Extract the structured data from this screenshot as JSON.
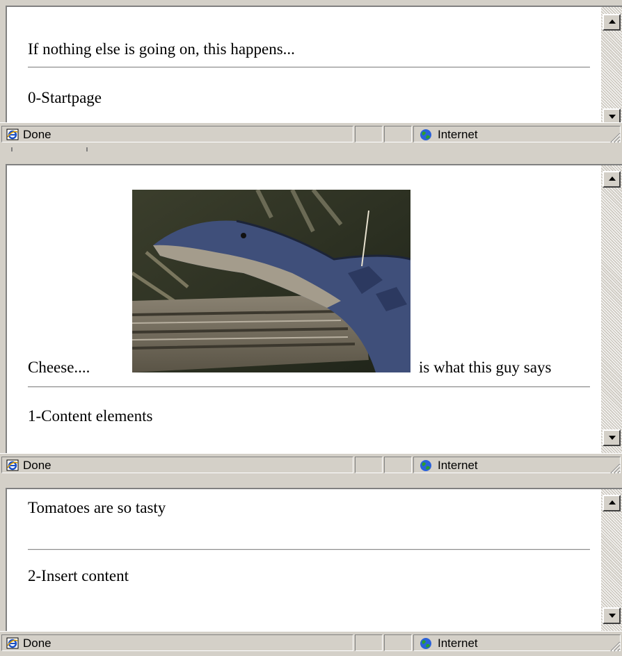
{
  "windows": [
    {
      "body_text": "If nothing else is going on, this happens...",
      "page_label": "0-Startpage",
      "status": {
        "text": "Done",
        "zone": "Internet",
        "icon": "ie-page-icon",
        "zone_icon": "globe-icon"
      }
    },
    {
      "pre_image_text": "Cheese....",
      "image_alt": "alligator",
      "post_image_text": "is what this guy says",
      "page_label": "1-Content elements",
      "status": {
        "text": "Done",
        "zone": "Internet",
        "icon": "ie-page-icon",
        "zone_icon": "globe-icon"
      }
    },
    {
      "body_text": "Tomatoes are so tasty",
      "page_label": "2-Insert content",
      "status": {
        "text": "Done",
        "zone": "Internet",
        "icon": "ie-page-icon",
        "zone_icon": "globe-icon"
      }
    }
  ],
  "colors": {
    "chrome": "#d4d0c8",
    "page_bg": "#ffffff"
  }
}
